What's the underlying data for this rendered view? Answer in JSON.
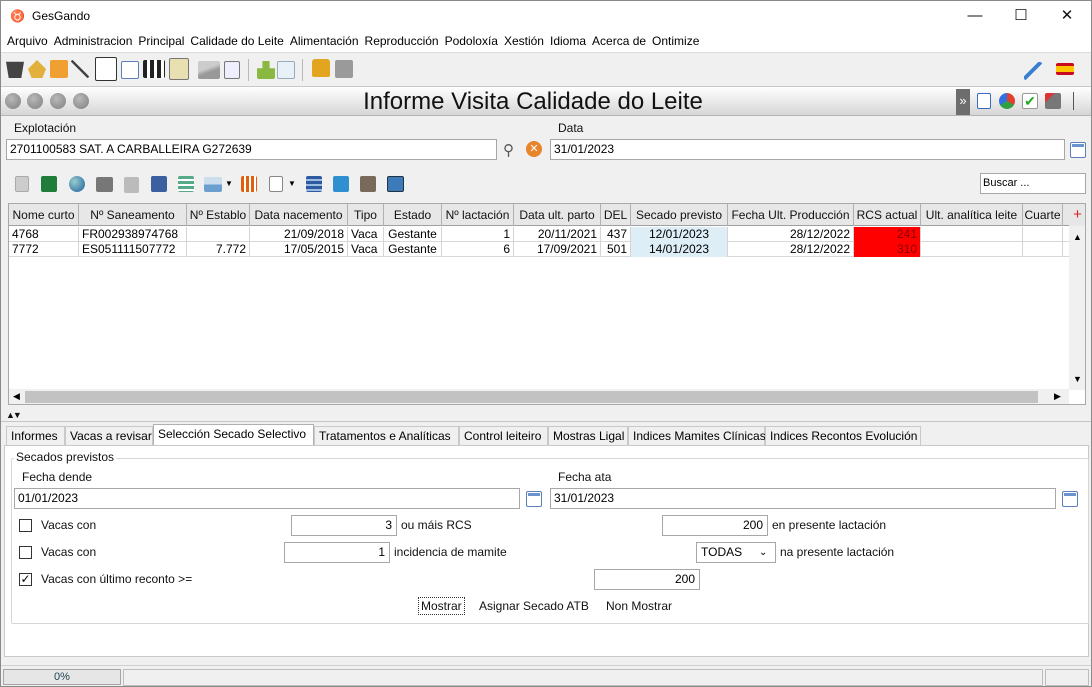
{
  "window": {
    "title": "GesGando",
    "minimize": "—",
    "maximize": "☐",
    "close": "✕"
  },
  "menu": [
    "Arquivo",
    "Administracion",
    "Principal",
    "Calidade do Leite",
    "Alimentación",
    "Reproducción",
    "Podoloxía",
    "Xestión",
    "Idioma",
    "Acerca de",
    "Ontimize"
  ],
  "header": {
    "title": "Informe Visita Calidade do Leite",
    "chevron": "»"
  },
  "filters": {
    "explotacion_label": "Explotación",
    "explotacion_value": "2701100583 SAT. A CARBALLEIRA G272639",
    "data_label": "Data",
    "data_value": "31/01/2023",
    "search_placeholder": "Buscar ..."
  },
  "table": {
    "columns": [
      "Nome curto",
      "Nº Saneamento",
      "Nº Establo",
      "Data nacemento",
      "Tipo",
      "Estado",
      "Nº lactación",
      "Data ult. parto",
      "DEL",
      "Secado previsto",
      "Fecha Ult. Producción",
      "RCS actual",
      "Ult. analítica leite",
      "Cuarte"
    ],
    "add_column": "+",
    "rows": [
      [
        "4768",
        "FR002938974768",
        "",
        "21/09/2018",
        "Vaca",
        "Gestante",
        "1",
        "20/11/2021",
        "437",
        "12/01/2023",
        "28/12/2022",
        "241",
        "",
        ""
      ],
      [
        "7772",
        "ES051111507772",
        "7.772",
        "17/05/2015",
        "Vaca",
        "Gestante",
        "6",
        "17/09/2021",
        "501",
        "14/01/2023",
        "28/12/2022",
        "310",
        "",
        ""
      ]
    ],
    "highlight_color_rcs": "#ff0000",
    "highlight_color_secado": "#ddeef6"
  },
  "tabs": [
    "Informes",
    "Vacas a revisar",
    "Selección Secado Selectivo",
    "Tratamentos e Analíticas",
    "Control leiteiro",
    "Mostras Ligal",
    "Indices Mamites Clínicas",
    "Indices Recontos Evolución"
  ],
  "active_tab": 2,
  "secado": {
    "group_title": "Secados previstos",
    "fecha_dende_label": "Fecha dende",
    "fecha_dende": "01/01/2023",
    "fecha_ata_label": "Fecha ata",
    "fecha_ata": "31/01/2023",
    "row1": {
      "label": "Vacas con",
      "value": "3",
      "suffix": "ou máis RCS",
      "value2": "200",
      "suffix2": "en presente lactación",
      "checked": false
    },
    "row2": {
      "label": "Vacas con",
      "value": "1",
      "suffix": "incidencia de mamite",
      "select": "TODAS",
      "suffix2": "na presente lactación",
      "checked": false
    },
    "row3": {
      "label": "Vacas con último reconto >=",
      "value": "200",
      "checked": true,
      "check_mark": "✓"
    },
    "buttons": {
      "mostrar": "Mostrar",
      "asignar": "Asignar Secado ATB",
      "non_mostrar": "Non Mostrar"
    }
  },
  "status": {
    "progress": "0%"
  }
}
